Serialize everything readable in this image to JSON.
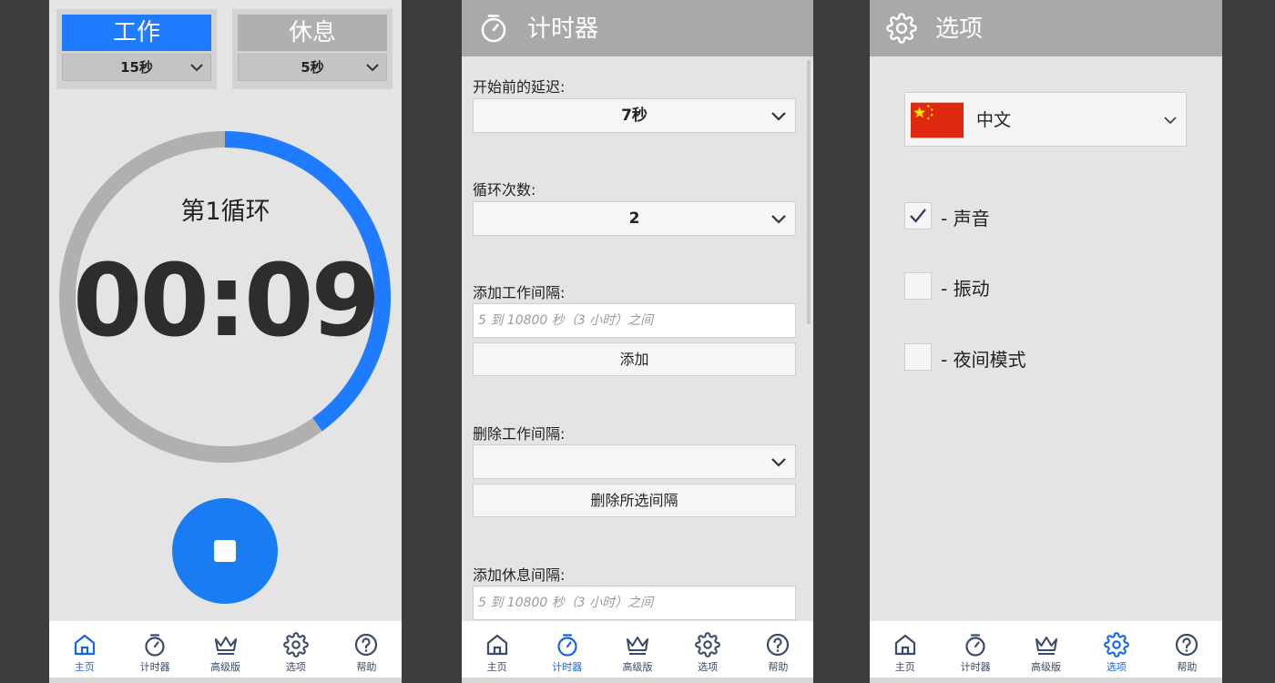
{
  "home": {
    "work_title": "工作",
    "work_value": "15秒",
    "rest_title": "休息",
    "rest_value": "5秒",
    "cycle_label": "第1循环",
    "time_display": "00:09",
    "progress_fraction": 0.4,
    "colors": {
      "accent": "#1f7bff",
      "ring_track": "#b0b0b0",
      "stop_button": "#1a7cf2"
    },
    "stop_icon": "stop-icon"
  },
  "timer": {
    "title": "计时器",
    "delay_label": "开始前的延迟:",
    "delay_value": "7秒",
    "cycles_label": "循环次数:",
    "cycles_value": "2",
    "add_work_label": "添加工作间隔:",
    "add_work_placeholder": "5 到 10800 秒（3 小时）之间",
    "add_button": "添加",
    "delete_work_label": "删除工作间隔:",
    "delete_work_value": "",
    "delete_button": "删除所选间隔",
    "add_rest_label": "添加休息间隔:",
    "add_rest_placeholder": "5 到 10800 秒（3 小时）之间"
  },
  "options": {
    "title": "选项",
    "language": "中文",
    "flag_icon": "china-flag-icon",
    "settings": [
      {
        "label": "- 声音",
        "checked": true
      },
      {
        "label": "- 振动",
        "checked": false
      },
      {
        "label": "- 夜间模式",
        "checked": false
      }
    ]
  },
  "nav": {
    "items": [
      {
        "label": "主页",
        "icon": "home-icon"
      },
      {
        "label": "计时器",
        "icon": "stopwatch-icon"
      },
      {
        "label": "高级版",
        "icon": "crown-icon"
      },
      {
        "label": "选项",
        "icon": "gear-icon"
      },
      {
        "label": "帮助",
        "icon": "help-icon"
      }
    ],
    "active": {
      "home": 0,
      "timer": 1,
      "options": 3
    }
  }
}
